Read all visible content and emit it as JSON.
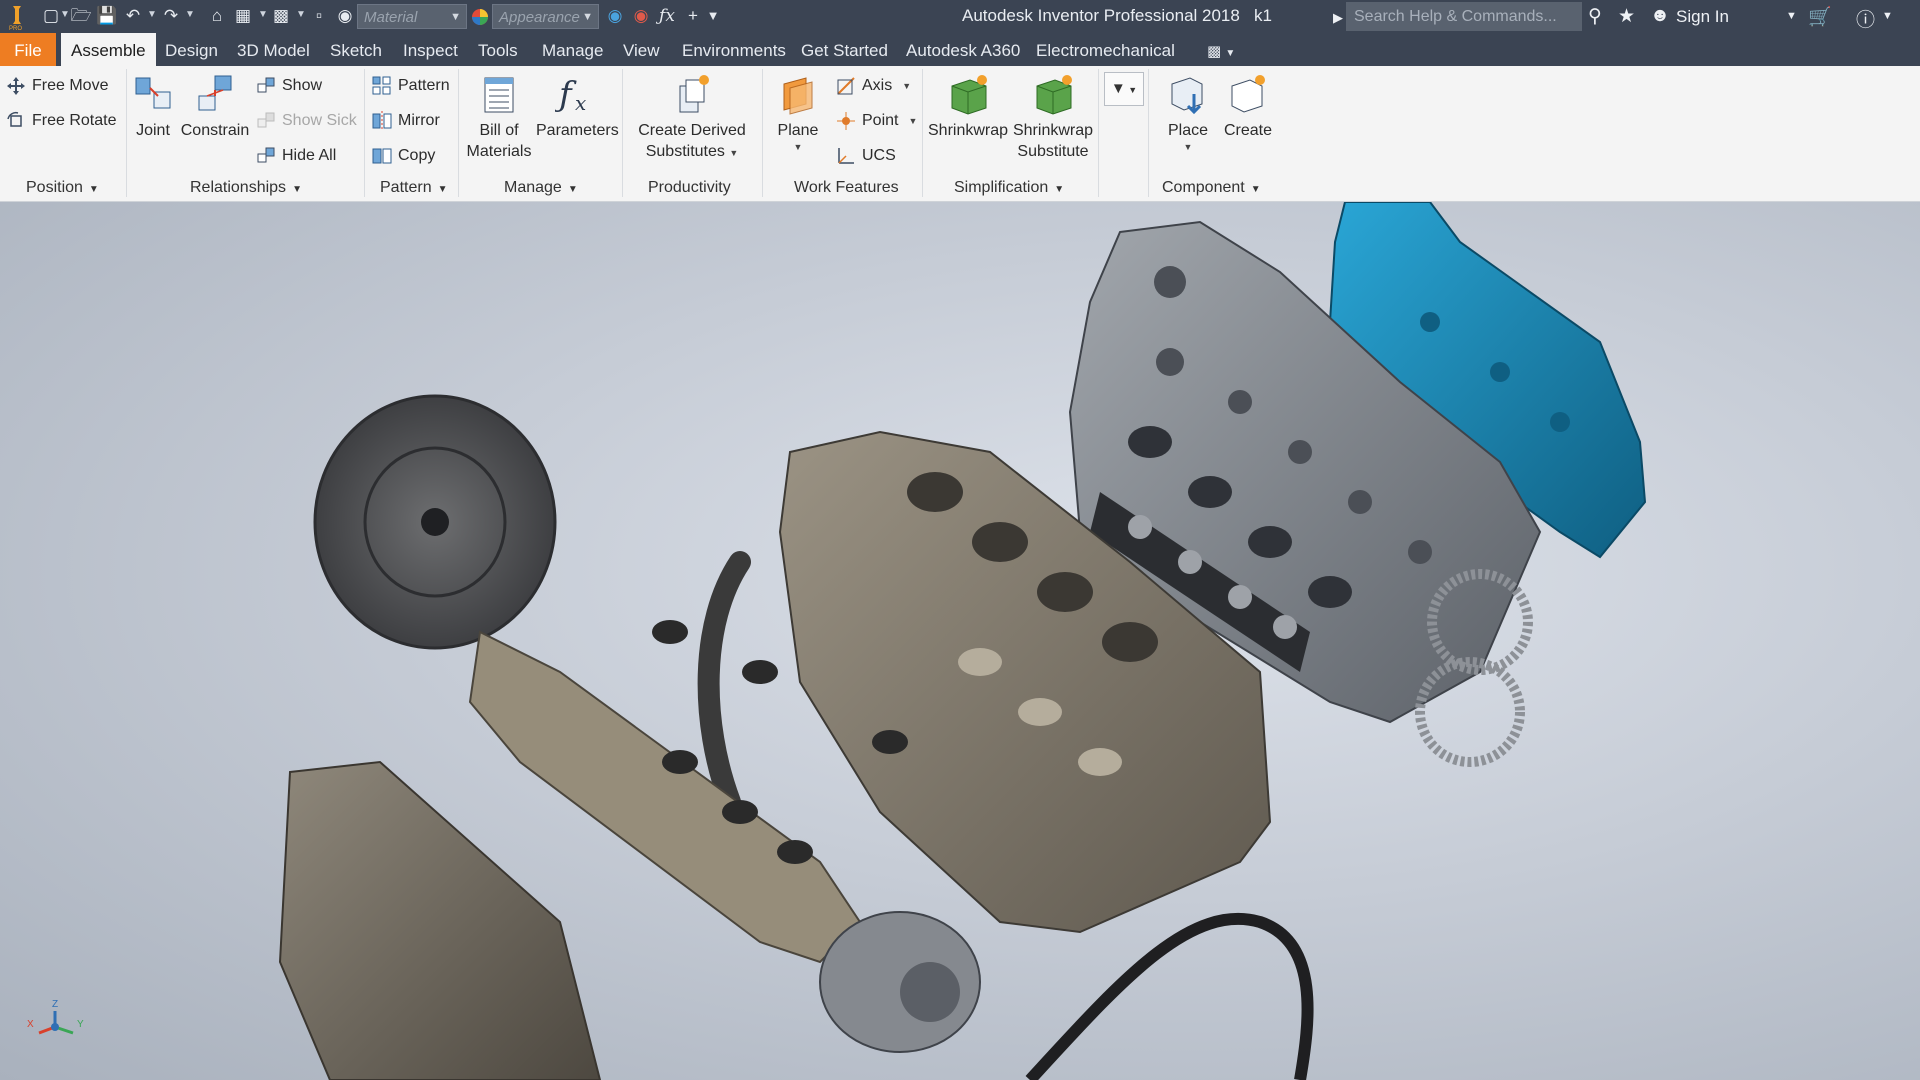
{
  "window": {
    "title": "Autodesk Inventor Professional 2018",
    "document": "k1"
  },
  "quick_access": {
    "material_placeholder": "Material",
    "appearance_placeholder": "Appearance",
    "search_placeholder": "Search Help & Commands...",
    "sign_in": "Sign In"
  },
  "tabs": [
    {
      "label": "File"
    },
    {
      "label": "Assemble"
    },
    {
      "label": "Design"
    },
    {
      "label": "3D Model"
    },
    {
      "label": "Sketch"
    },
    {
      "label": "Inspect"
    },
    {
      "label": "Tools"
    },
    {
      "label": "Manage"
    },
    {
      "label": "View"
    },
    {
      "label": "Environments"
    },
    {
      "label": "Get Started"
    },
    {
      "label": "Autodesk A360"
    },
    {
      "label": "Electromechanical"
    }
  ],
  "ribbon": {
    "position": {
      "free_move": "Free Move",
      "free_rotate": "Free Rotate",
      "label": "Position"
    },
    "relationships": {
      "joint": "Joint",
      "constrain": "Constrain",
      "show": "Show",
      "show_sick": "Show Sick",
      "hide_all": "Hide All",
      "label": "Relationships"
    },
    "pattern": {
      "pattern": "Pattern",
      "mirror": "Mirror",
      "copy": "Copy",
      "label": "Pattern"
    },
    "manage": {
      "bom_line1": "Bill of",
      "bom_line2": "Materials",
      "parameters": "Parameters",
      "label": "Manage"
    },
    "productivity": {
      "cds_line1": "Create Derived",
      "cds_line2": "Substitutes",
      "label": "Productivity"
    },
    "work_features": {
      "plane": "Plane",
      "axis": "Axis",
      "point": "Point",
      "ucs": "UCS",
      "label": "Work Features"
    },
    "simplification": {
      "shrinkwrap": "Shrinkwrap",
      "sws_line1": "Shrinkwrap",
      "sws_line2": "Substitute",
      "label": "Simplification"
    },
    "component": {
      "place": "Place",
      "create": "Create",
      "label": "Component"
    }
  },
  "viewport": {
    "axis_labels": {
      "x": "X",
      "y": "Y",
      "z": "Z"
    },
    "highlight_color": "#1d87b4",
    "part_color": "#8a8274"
  }
}
